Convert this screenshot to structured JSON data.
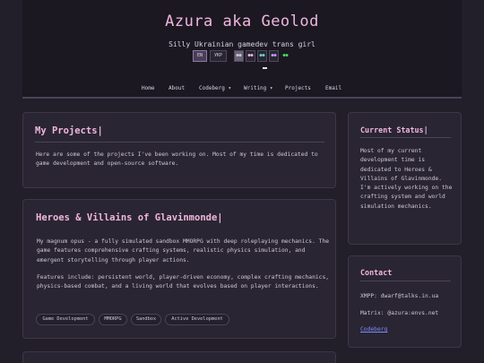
{
  "header": {
    "title": "Azura aka Geolod",
    "tagline": "Silly Ukrainian gamedev trans girl",
    "languages": [
      "EN",
      "УКР"
    ],
    "theme_buttons": [
      "●●",
      "●●",
      "●●",
      "●●",
      "●●"
    ],
    "theme_colors": [
      "#8a8294",
      "#f0b6dd",
      "#69d6c8",
      "#c49cff",
      "#4cd964"
    ]
  },
  "nav": {
    "items": [
      "Home",
      "About",
      "Codeberg ▾",
      "Writing ▾",
      "Projects",
      "Email"
    ]
  },
  "projects_intro": {
    "title": "My Projects|",
    "text": "Here are some of the projects I've been working on. Most of my time is dedicated to game development and open-source software."
  },
  "project": {
    "title": "Heroes & Villains of Glavinmonde|",
    "para1": "My magnum opus - a fully simulated sandbox MMORPG with deep roleplaying mechanics. The game features comprehensive crafting systems, realistic physics simulation, and emergent storytelling through player actions.",
    "para2": "Features include: persistent world, player-driven economy, complex crafting mechanics, physics-based combat, and a living world that evolves based on player interactions.",
    "tags": [
      "Game Development",
      "MMORPG",
      "Sandbox",
      "Active Development"
    ]
  },
  "status": {
    "title": "Current Status|",
    "text": "Most of my current development time is dedicated to Heroes & Villains of Glavinmonde. I'm actively working on the crafting system and world simulation mechanics."
  },
  "contact": {
    "title": "Contact",
    "xmpp": "XMPP: dwarf@talks.in.ua",
    "matrix": "Matrix: @azura:envs.net",
    "link": "Codeberg"
  }
}
